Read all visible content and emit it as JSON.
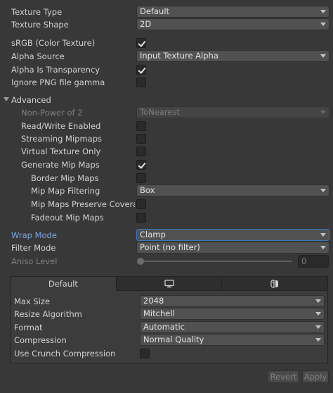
{
  "settings": {
    "texture_type": {
      "label": "Texture Type",
      "value": "Default"
    },
    "texture_shape": {
      "label": "Texture Shape",
      "value": "2D"
    },
    "srgb": {
      "label": "sRGB (Color Texture)",
      "checked": true
    },
    "alpha_source": {
      "label": "Alpha Source",
      "value": "Input Texture Alpha"
    },
    "alpha_is_transparency": {
      "label": "Alpha Is Transparency",
      "checked": true
    },
    "ignore_png_gamma": {
      "label": "Ignore PNG file gamma",
      "checked": false
    }
  },
  "advanced": {
    "label": "Advanced",
    "non_power_of_2": {
      "label": "Non-Power of 2",
      "value": "ToNearest"
    },
    "read_write": {
      "label": "Read/Write Enabled",
      "checked": false
    },
    "streaming_mipmaps": {
      "label": "Streaming Mipmaps",
      "checked": false
    },
    "virtual_texture_only": {
      "label": "Virtual Texture Only",
      "checked": false
    },
    "generate_mip_maps": {
      "label": "Generate Mip Maps",
      "checked": true
    },
    "border_mip_maps": {
      "label": "Border Mip Maps",
      "checked": false
    },
    "mip_map_filtering": {
      "label": "Mip Map Filtering",
      "value": "Box"
    },
    "mip_maps_preserve_coverage": {
      "label": "Mip Maps Preserve Coverage",
      "checked": false
    },
    "fadeout_mip_maps": {
      "label": "Fadeout Mip Maps",
      "checked": false
    }
  },
  "wrap_mode": {
    "label": "Wrap Mode",
    "value": "Clamp"
  },
  "filter_mode": {
    "label": "Filter Mode",
    "value": "Point (no filter)"
  },
  "aniso_level": {
    "label": "Aniso Level",
    "value": "0"
  },
  "platform": {
    "tabs": [
      {
        "label": "Default",
        "icon": ""
      },
      {
        "label": "",
        "icon": "monitor-icon"
      },
      {
        "label": "",
        "icon": "switch-icon"
      }
    ],
    "max_size": {
      "label": "Max Size",
      "value": "2048"
    },
    "resize_algorithm": {
      "label": "Resize Algorithm",
      "value": "Mitchell"
    },
    "format": {
      "label": "Format",
      "value": "Automatic"
    },
    "compression": {
      "label": "Compression",
      "value": "Normal Quality"
    },
    "use_crunch": {
      "label": "Use Crunch Compression",
      "checked": false
    }
  },
  "footer": {
    "revert_label": "Revert",
    "apply_label": "Apply"
  }
}
